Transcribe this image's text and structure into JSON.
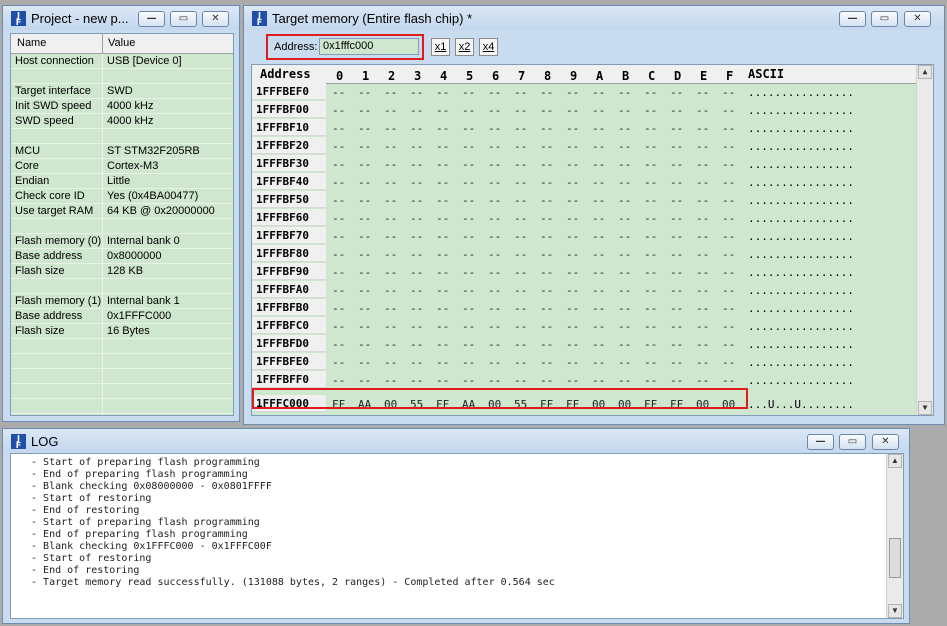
{
  "project": {
    "title": "Project - new p...",
    "col_name": "Name",
    "col_value": "Value",
    "rows": [
      {
        "name": "Host connection",
        "value": "USB [Device 0]"
      },
      {
        "name": "",
        "value": ""
      },
      {
        "name": "Target interface",
        "value": "SWD"
      },
      {
        "name": "Init SWD speed",
        "value": "4000 kHz"
      },
      {
        "name": "SWD speed",
        "value": "4000 kHz"
      },
      {
        "name": "",
        "value": ""
      },
      {
        "name": "MCU",
        "value": "ST STM32F205RB"
      },
      {
        "name": "Core",
        "value": "Cortex-M3"
      },
      {
        "name": "Endian",
        "value": "Little"
      },
      {
        "name": "Check core ID",
        "value": "Yes (0x4BA00477)"
      },
      {
        "name": "Use target RAM",
        "value": "64 KB @ 0x20000000"
      },
      {
        "name": "",
        "value": ""
      },
      {
        "name": "Flash memory (0)",
        "value": "Internal bank 0"
      },
      {
        "name": "Base address",
        "value": "0x8000000"
      },
      {
        "name": "Flash size",
        "value": "128 KB"
      },
      {
        "name": "",
        "value": ""
      },
      {
        "name": "Flash memory (1)",
        "value": "Internal bank 1"
      },
      {
        "name": "Base address",
        "value": "0x1FFFC000"
      },
      {
        "name": "Flash size",
        "value": "16 Bytes"
      },
      {
        "name": "",
        "value": ""
      },
      {
        "name": "",
        "value": ""
      },
      {
        "name": "",
        "value": ""
      },
      {
        "name": "",
        "value": ""
      },
      {
        "name": "",
        "value": ""
      },
      {
        "name": "",
        "value": ""
      }
    ]
  },
  "memory": {
    "title": "Target memory (Entire flash chip) *",
    "address_label": "Address:",
    "address_value": "0x1fffc000",
    "x1": "x1",
    "x2": "x2",
    "x4": "x4",
    "hdr_address": "Address",
    "hdr_cols": [
      "0",
      "1",
      "2",
      "3",
      "4",
      "5",
      "6",
      "7",
      "8",
      "9",
      "A",
      "B",
      "C",
      "D",
      "E",
      "F"
    ],
    "hdr_ascii": "ASCII",
    "empty_byte": "--",
    "empty_ascii": "................",
    "rows": [
      "1FFFBEF0",
      "1FFFBF00",
      "1FFFBF10",
      "1FFFBF20",
      "1FFFBF30",
      "1FFFBF40",
      "1FFFBF50",
      "1FFFBF60",
      "1FFFBF70",
      "1FFFBF80",
      "1FFFBF90",
      "1FFFBFA0",
      "1FFFBFB0",
      "1FFFBFC0",
      "1FFFBFD0",
      "1FFFBFE0",
      "1FFFBFF0"
    ],
    "data_row": {
      "address": "1FFFC000",
      "bytes": [
        "FF",
        "AA",
        "00",
        "55",
        "FF",
        "AA",
        "00",
        "55",
        "FF",
        "FF",
        "00",
        "00",
        "FF",
        "FF",
        "00",
        "00"
      ],
      "ascii": "...U...U........"
    }
  },
  "log": {
    "title": "LOG",
    "lines": [
      " - Start of preparing flash programming",
      " - End of preparing flash programming",
      " - Blank checking 0x08000000 - 0x0801FFFF",
      " - Start of restoring",
      " - End of restoring",
      " - Start of preparing flash programming",
      " - End of preparing flash programming",
      " - Blank checking 0x1FFFC000 - 0x1FFFC00F",
      " - Start of restoring",
      " - End of restoring",
      " - Target memory read successfully. (131088 bytes, 2 ranges) - Completed after 0.564 sec"
    ]
  },
  "colors": {
    "grid_bg": "#cfe6cf",
    "highlight": "#e01b1b",
    "frame": "#c9dbee"
  }
}
